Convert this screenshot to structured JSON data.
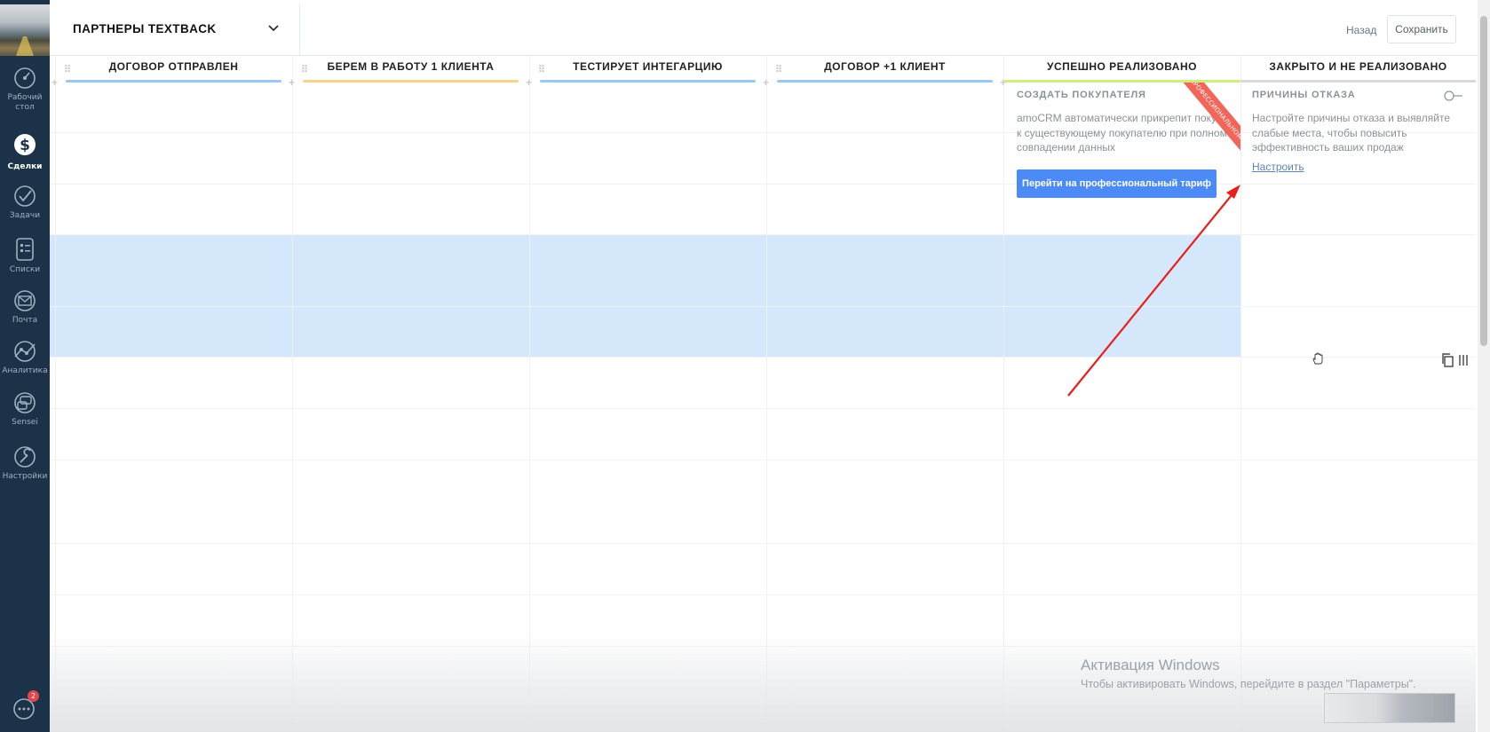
{
  "sidebar": {
    "items": [
      {
        "label": "Рабочий стол",
        "icon": "dashboard-icon"
      },
      {
        "label": "Сделки",
        "icon": "deals-icon"
      },
      {
        "label": "Задачи",
        "icon": "tasks-icon"
      },
      {
        "label": "Списки",
        "icon": "lists-icon"
      },
      {
        "label": "Почта",
        "icon": "mail-icon"
      },
      {
        "label": "Аналитика",
        "icon": "analytics-icon"
      },
      {
        "label": "Sensei",
        "icon": "sensei-icon"
      },
      {
        "label": "Настройки",
        "icon": "settings-icon"
      }
    ],
    "chat_badge": "2"
  },
  "header": {
    "pipeline_name": "ПАРТНЕРЫ TEXTBACK",
    "back_label": "Назад",
    "save_label": "Сохранить"
  },
  "stages": [
    {
      "name": "ДОГОВОР ОТПРАВЛЕН",
      "color": "#99c8f5"
    },
    {
      "name": "БЕРЕМ В РАБОТУ 1 КЛИЕНТА",
      "color": "#fbd28a"
    },
    {
      "name": "ТЕСТИРУЕТ ИНТЕГАРЦИЮ",
      "color": "#99c8f5"
    },
    {
      "name": "ДОГОВОР +1 КЛИЕНТ",
      "color": "#99c8f5"
    },
    {
      "name": "УСПЕШНО РЕАЛИЗОВАНО",
      "color": "#ccf07a"
    },
    {
      "name": "ЗАКРЫТО И НЕ РЕАЛИЗОВАНО",
      "color": "#d6dadd"
    }
  ],
  "promo_card": {
    "title": "СОЗДАТЬ ПОКУПАТЕЛЯ",
    "text": "amoCRM автоматически прикрепит покупку к существующему покупателю при полном совпадении данных",
    "button": "Перейти на профессиональный тариф",
    "ribbon": "В ПРОФЕССИОНАЛЬНОМ"
  },
  "loss_reasons": {
    "title": "ПРИЧИНЫ ОТКАЗА",
    "text": "Настройте причины отказа и выявляйте слабые места, чтобы повысить эффективность ваших продаж",
    "link": "Настроить"
  },
  "activation": {
    "title": "Активация Windows",
    "subtitle": "Чтобы активировать Windows, перейдите в раздел \"Параметры\"."
  },
  "colors": {
    "sidebar": "#1c3248",
    "accent_button": "#4c8bf5",
    "highlight": "#d5e7fa",
    "arrow": "#e8201c"
  }
}
